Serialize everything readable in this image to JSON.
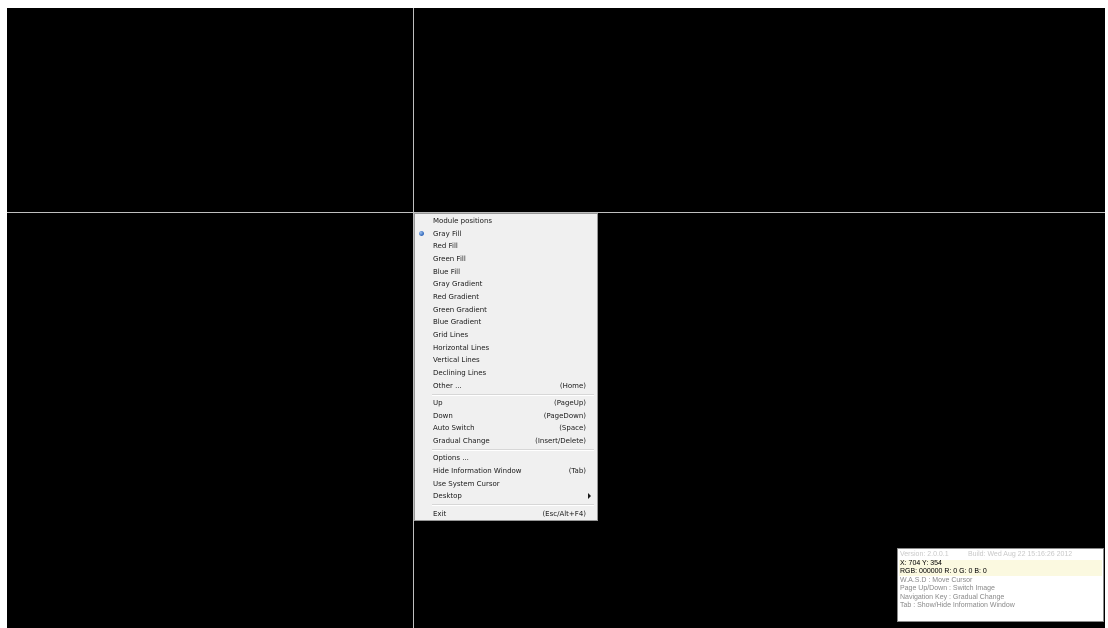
{
  "menu": {
    "items": [
      {
        "label": "Module positions",
        "key": ""
      },
      {
        "label": "Gray Fill",
        "key": "",
        "selected": true
      },
      {
        "label": "Red Fill",
        "key": ""
      },
      {
        "label": "Green Fill",
        "key": ""
      },
      {
        "label": "Blue Fill",
        "key": ""
      },
      {
        "label": "Gray Gradient",
        "key": ""
      },
      {
        "label": "Red Gradient",
        "key": ""
      },
      {
        "label": "Green Gradient",
        "key": ""
      },
      {
        "label": "Blue Gradient",
        "key": ""
      },
      {
        "label": "Grid Lines",
        "key": ""
      },
      {
        "label": "Horizontal Lines",
        "key": ""
      },
      {
        "label": "Vertical Lines",
        "key": ""
      },
      {
        "label": "Declining Lines",
        "key": ""
      },
      {
        "label": "Other ...",
        "key": "(Home)"
      },
      {
        "label": "Up",
        "key": "(PageUp)"
      },
      {
        "label": "Down",
        "key": "(PageDown)"
      },
      {
        "label": "Auto Switch",
        "key": "(Space)"
      },
      {
        "label": "Gradual Change",
        "key": "(Insert/Delete)"
      },
      {
        "label": "Options ...",
        "key": ""
      },
      {
        "label": "Hide Information Window",
        "key": "(Tab)"
      },
      {
        "label": "Use System Cursor",
        "key": ""
      },
      {
        "label": "Desktop",
        "key": "",
        "submenu": true
      },
      {
        "label": "Exit",
        "key": "(Esc/Alt+F4)"
      }
    ]
  },
  "info": {
    "version": "Version: 2.0.0.1",
    "build": "Build: Wed Aug 22 15:16:26 2012",
    "coords": "X:  704   Y:  354",
    "rgb": "RGB: 000000   R:  0   G:  0   B:  0",
    "help_wasd": "W.A.S.D : Move Cursor",
    "help_page": "Page Up/Down : Switch Image",
    "help_nav": "Navigation Key : Gradual Change",
    "help_tab": "Tab : Show/Hide Information Window"
  },
  "colors": {
    "screen": "#000000",
    "crosshair": "#bfbfbf",
    "menu_bg": "#f0f0f0",
    "highlight": "#fbf9e0"
  }
}
